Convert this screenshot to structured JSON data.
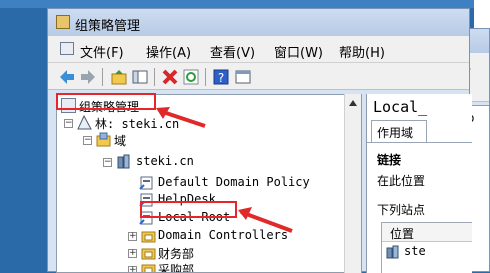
{
  "window": {
    "title": "组策略管理"
  },
  "menu": {
    "file": "文件(F)",
    "action": "操作(A)",
    "view": "查看(V)",
    "window": "窗口(W)",
    "help": "帮助(H)"
  },
  "toolbar": {
    "icons": [
      "back-arrow-icon",
      "forward-arrow-icon",
      "up-folder-icon",
      "show-hide-tree-icon",
      "delete-icon",
      "refresh-icon",
      "help-icon",
      "properties-icon"
    ]
  },
  "tree": {
    "root": "组策略管理",
    "forest": "林: steki.cn",
    "domains": "域",
    "domain": "steki.cn",
    "items": [
      "Default Domain Policy",
      "HelpDesk",
      "Local Root",
      "Domain Controllers",
      "财务部",
      "采购部"
    ]
  },
  "right_pane": {
    "title": "Local_",
    "tab": "作用域",
    "links_heading": "链接",
    "location_text": "在此位置",
    "sites_text": "下列站点",
    "column_location": "位置",
    "row_text": "ste"
  },
  "second_window": {
    "title": "组",
    "menu_file": "文件",
    "tree_item": "Lo"
  },
  "colors": {
    "highlight": "#e8262a",
    "desktop": "#2b6aa8",
    "window_frame": "#d6e3f2"
  }
}
